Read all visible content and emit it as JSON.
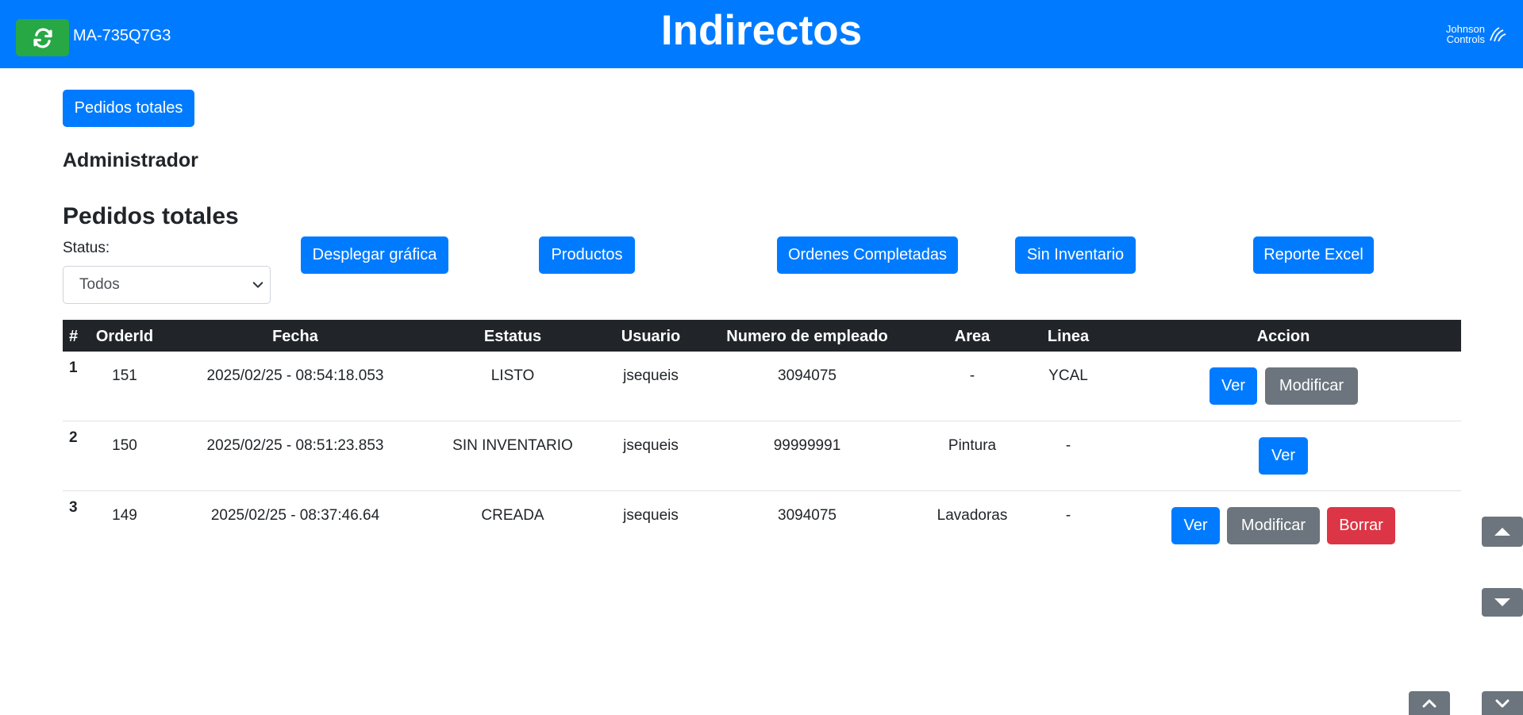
{
  "header": {
    "machine_id": "MA-735Q7G3",
    "title": "Indirectos",
    "brand_line1": "Johnson",
    "brand_line2": "Controls",
    "refresh_icon": "refresh-icon"
  },
  "nav": {
    "pedidos_totales_label": "Pedidos totales"
  },
  "user": {
    "role": "Administrador"
  },
  "section": {
    "title": "Pedidos totales",
    "status_label": "Status:",
    "status_selected": "Todos"
  },
  "toolbar": {
    "chart_label": "Desplegar gráfica",
    "products_label": "Productos",
    "completed_label": "Ordenes Completadas",
    "no_stock_label": "Sin Inventario",
    "excel_label": "Reporte Excel"
  },
  "table": {
    "headers": [
      "#",
      "OrderId",
      "Fecha",
      "Estatus",
      "Usuario",
      "Numero de empleado",
      "Area",
      "Linea",
      "Accion"
    ],
    "rows": [
      {
        "idx": "1",
        "order_id": "151",
        "fecha": "2025/02/25 - 08:54:18.053",
        "estatus": "LISTO",
        "usuario": "jsequeis",
        "empleado": "3094075",
        "area": "-",
        "linea": "YCAL",
        "actions": [
          "Ver",
          "Modificar"
        ]
      },
      {
        "idx": "2",
        "order_id": "150",
        "fecha": "2025/02/25 - 08:51:23.853",
        "estatus": "SIN INVENTARIO",
        "usuario": "jsequeis",
        "empleado": "99999991",
        "area": "Pintura",
        "linea": "-",
        "actions": [
          "Ver"
        ]
      },
      {
        "idx": "3",
        "order_id": "149",
        "fecha": "2025/02/25 - 08:37:46.64",
        "estatus": "CREADA",
        "usuario": "jsequeis",
        "empleado": "3094075",
        "area": "Lavadoras",
        "linea": "-",
        "actions": [
          "Ver",
          "Modificar",
          "Borrar"
        ]
      }
    ]
  },
  "colors": {
    "primary": "#007bff",
    "secondary": "#6c757d",
    "danger": "#dc3545",
    "success": "#28a745",
    "table_header": "#212529"
  }
}
